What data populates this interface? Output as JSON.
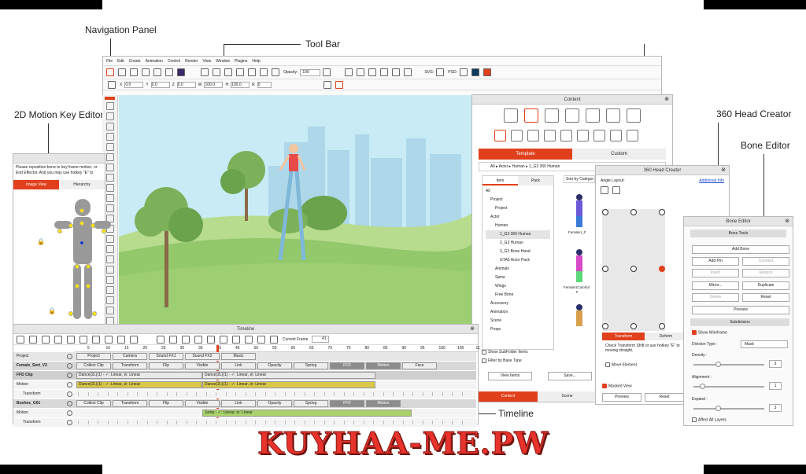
{
  "callouts": {
    "navigation": "Navigation Panel",
    "toolbar": "Tool Bar",
    "motion_key": "2D Motion Key Editor",
    "head360": "360 Head Creator",
    "bone": "Bone Editor",
    "timeline": "Timeline"
  },
  "menu": [
    "File",
    "Edit",
    "Create",
    "Animation",
    "Control",
    "Render",
    "View",
    "Window",
    "Plugins",
    "Help"
  ],
  "toolbar": {
    "opacity_label": "Opacity:",
    "opacity_value": "100",
    "svg": "SVG:",
    "psd": "PSD:"
  },
  "transform": {
    "x": "X",
    "x_val": "0.0",
    "y": "Y",
    "y_val": "0.0",
    "z": "Z",
    "z_val": "0.0",
    "w": "W",
    "w_val": "100.0",
    "h": "H",
    "h_val": "100.0",
    "r": "R",
    "r_val": "0"
  },
  "motion_key": {
    "instructions": "Please reposition bone to key frame motion, or End Effector. And you may use hotkey \"E\" to",
    "tab_image": "Image View",
    "tab_hier": "Hierarchy"
  },
  "content": {
    "title": "Content",
    "tab_template": "Template",
    "tab_custom": "Custom",
    "path": "All ▸ Actor ▸ Human ▸ 1_G3 360 Human",
    "sub_item": "Item",
    "sub_pack": "Pack",
    "sort": "Sort by Categor",
    "tree": [
      "All",
      "Project",
      "Project",
      "Actor",
      "Human",
      "1_G3 360 Human",
      "2_G3 Human",
      "3_G3 Bone Hand",
      "GTA5 Actor Pack",
      "Animals",
      "Spine",
      "Wings",
      "Free Bone",
      "Accessory",
      "Animation",
      "Scene",
      "Props"
    ],
    "show_sub": "Show SubFolder Items",
    "filter": "Filter by Base Type",
    "view_items": "View Items",
    "save": "Save...",
    "thumb1": "Female1_F",
    "thumb2": "Female1Colorful",
    "thumb2b": "F",
    "bottom_content": "Content",
    "bottom_scene": "Scene"
  },
  "head360": {
    "title": "360 Head Creator",
    "angle": "Angle Layout:",
    "additional": "Additional Info",
    "tab_transform": "Transform",
    "tab_deform": "Deform",
    "note": "Check Transform Shift or use hotkey \"E\" to moving straight.",
    "move_element": "Move Element",
    "masked_view": "Masked View",
    "preview": "Preview",
    "reset": "Reset"
  },
  "bone_editor": {
    "title": "Bone Editor",
    "bone_tools": "Bone Tools",
    "add_bone": "Add Bone",
    "add_pin": "Add Pin",
    "connect": "Connect",
    "insert": "Insert",
    "reduce": "Reduce",
    "mirror": "Mirror...",
    "duplicate": "Duplicate",
    "delete": "Delete",
    "reset": "Reset",
    "preview": "Preview",
    "subdivision": "Subdivision",
    "show_wireframe": "Show Wireframe",
    "division_type": "Division Type :",
    "division_value": "Mask",
    "density": "Density :",
    "density_value": "3",
    "alignment": "Alignment :",
    "alignment_value": "1",
    "expand": "Expand :",
    "expand_value": "3",
    "affect_all": "Affect All Layers"
  },
  "timeline": {
    "title": "Timeline",
    "current_frame_label": "Current Frame",
    "current_frame": "41",
    "ruler": [
      "5",
      "10",
      "15",
      "20",
      "25",
      "30",
      "35",
      "40",
      "45",
      "50",
      "55",
      "60",
      "65",
      "70",
      "75",
      "80",
      "85",
      "90",
      "95",
      "100",
      "105",
      "11"
    ],
    "rows": [
      {
        "name": "Project",
        "cells": [
          "Project",
          "Camera",
          "Sound FX1",
          "Sound FX2",
          "Music"
        ]
      },
      {
        "name": "Female_Sort_V2",
        "cells": [
          "Collect Clip",
          "Transform",
          "Flip",
          "Visible",
          "Link",
          "Opacity",
          "Spring",
          "FFD",
          "Motion",
          "Face"
        ]
      },
      {
        "name": "FFD Clip",
        "cells": [
          "Dance(2L)(1) - ✓: Linear, ⊘: Linear",
          "Dance(2L)(1) - ✓: Linear, ⊘: Linear"
        ]
      },
      {
        "name": "Motion",
        "cells": [
          "Dance(2L)(1) - ✓: Linear, ⊘: Linear",
          "Dance(2L)(1) - ✓: Linear, ⊘: Linear"
        ]
      },
      {
        "name": "Transform",
        "cells": []
      },
      {
        "name": "Bushes_G01",
        "cells": [
          "Collect Clip",
          "Transform",
          "Flip",
          "Visible",
          "Link",
          "Opacity",
          "Spring",
          "FFD",
          "Motion"
        ]
      },
      {
        "name": "Motion",
        "cells": [
          "Jump - ✓: Linear, ⊘: Linear"
        ]
      },
      {
        "name": "Transform",
        "cells": []
      }
    ]
  },
  "watermark": "KUYHAA-ME.PW",
  "colors": {
    "accent": "#e0401c",
    "sky": "#c9ebf5",
    "grass": "#93c86b",
    "watermark": "#e8322c"
  }
}
